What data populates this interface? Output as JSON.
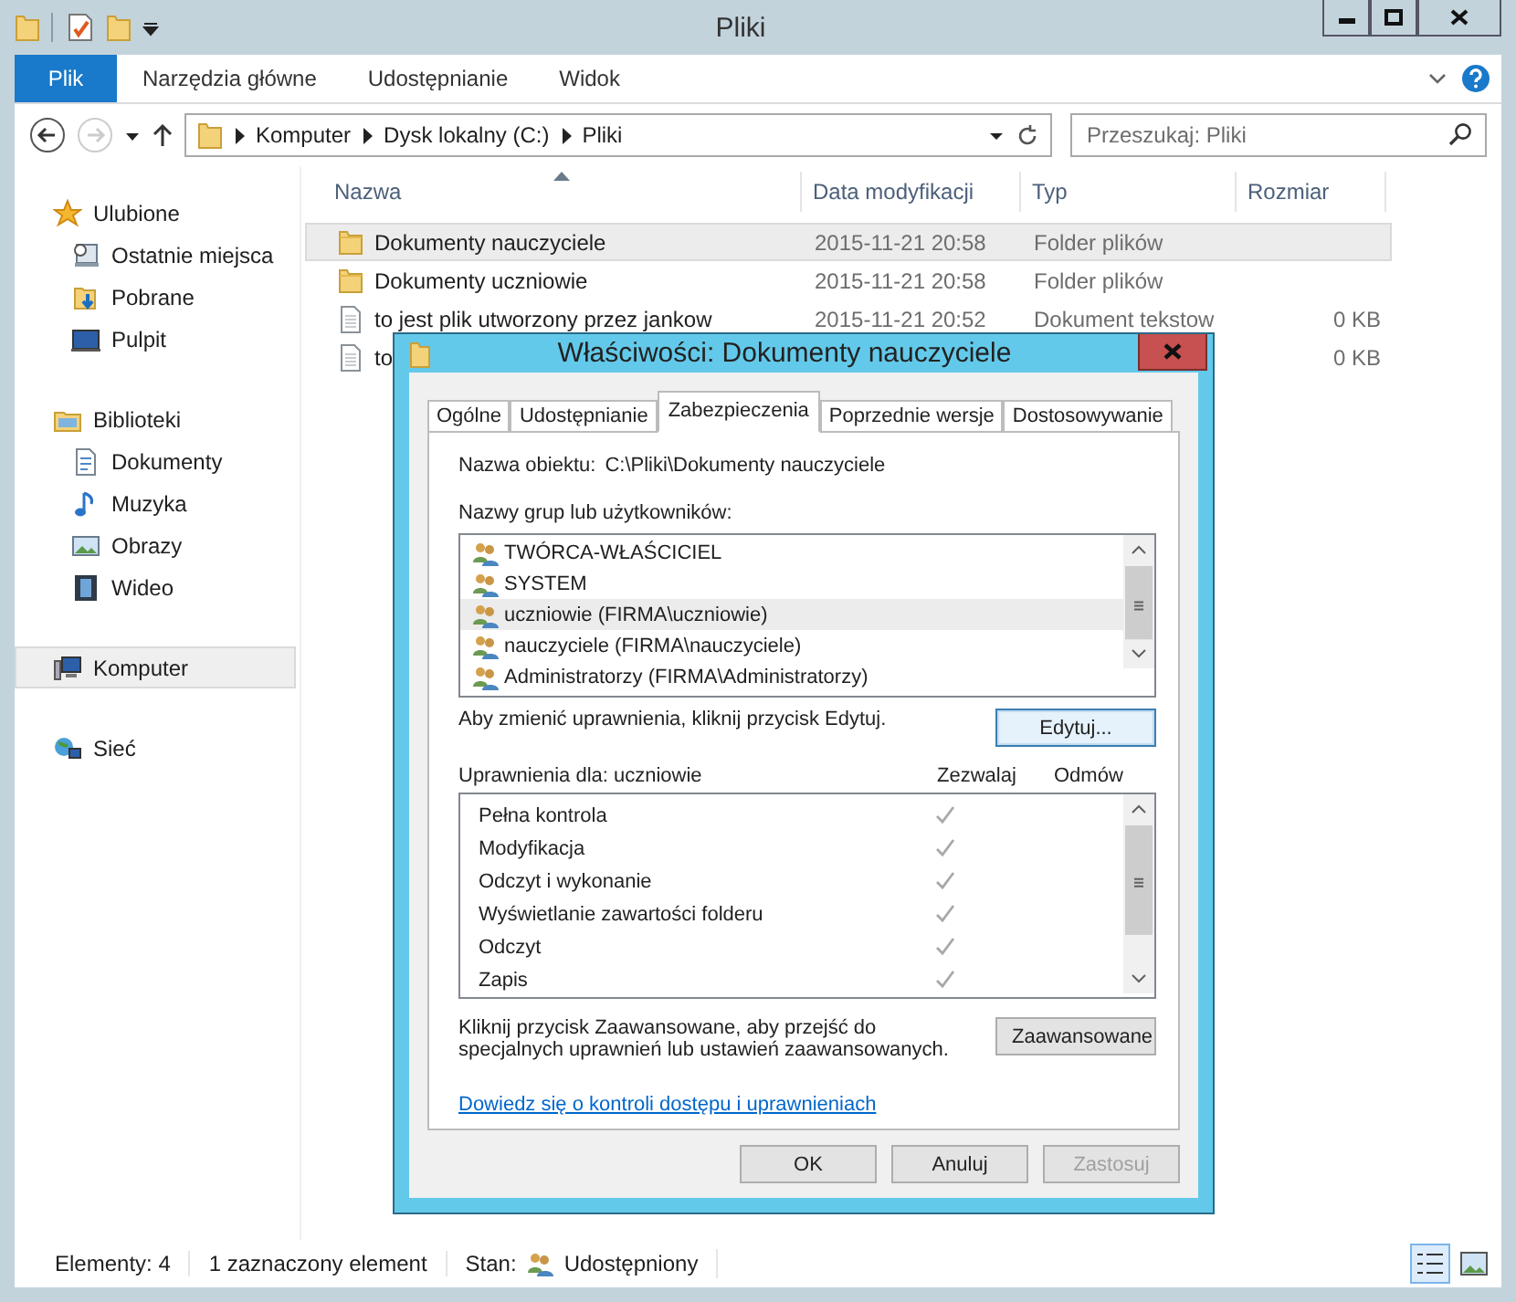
{
  "window": {
    "title": "Pliki"
  },
  "ribbon_tabs": [
    {
      "label": "Plik",
      "kind": "file"
    },
    {
      "label": "Narzędzia główne",
      "kind": "tab"
    },
    {
      "label": "Udostępnianie",
      "kind": "tab"
    },
    {
      "label": "Widok",
      "kind": "tab"
    }
  ],
  "address": {
    "path": [
      "Komputer",
      "Dysk lokalny (C:)",
      "Pliki"
    ]
  },
  "search": {
    "placeholder": "Przeszukaj: Pliki"
  },
  "nav": [
    {
      "label": "Ulubione",
      "kind": "star",
      "selected": false,
      "children": [
        {
          "label": "Ostatnie miejsca",
          "kind": "recent",
          "selected": false
        },
        {
          "label": "Pobrane",
          "kind": "download",
          "selected": false
        },
        {
          "label": "Pulpit",
          "kind": "desktop",
          "selected": false
        }
      ]
    },
    {
      "label": "Biblioteki",
      "kind": "library",
      "selected": false,
      "children": [
        {
          "label": "Dokumenty",
          "kind": "document",
          "selected": false
        },
        {
          "label": "Muzyka",
          "kind": "music",
          "selected": false
        },
        {
          "label": "Obrazy",
          "kind": "picture",
          "selected": false
        },
        {
          "label": "Wideo",
          "kind": "video",
          "selected": false
        }
      ]
    },
    {
      "label": "Komputer",
      "kind": "computer",
      "selected": true
    },
    {
      "label": "Sieć",
      "kind": "network",
      "selected": false
    }
  ],
  "columns": [
    "Nazwa",
    "Data modyfikacji",
    "Typ",
    "Rozmiar"
  ],
  "files": [
    {
      "kind": "folder",
      "name": "Dokumenty nauczyciele",
      "modified": "2015-11-21 20:58",
      "type": "Folder plików",
      "selected": true
    },
    {
      "kind": "folder",
      "name": "Dokumenty uczniowie",
      "modified": "2015-11-21 20:58",
      "type": "Folder plików",
      "selected": false
    },
    {
      "kind": "text",
      "name": "to jest plik utworzony przez jankow",
      "modified": "2015-11-21 20:52",
      "type": "Dokument tekstow",
      "size": "0 KB",
      "selected": false
    },
    {
      "kind": "text",
      "name": "to",
      "size": "0 KB",
      "selected": false
    }
  ],
  "status_bar": {
    "count": "Elementy: 4",
    "selection": "1 zaznaczony element",
    "state_label": "Stan:",
    "state": "Udostępniony",
    "views": [
      {
        "kind": "details",
        "selected": true
      },
      {
        "kind": "large",
        "selected": false
      }
    ]
  },
  "dialog": {
    "title": "Właściwości: Dokumenty nauczyciele",
    "tabs": [
      {
        "label": "Ogólne",
        "selected": false
      },
      {
        "label": "Udostępnianie",
        "selected": false
      },
      {
        "label": "Zabezpieczenia",
        "selected": true
      },
      {
        "label": "Poprzednie wersje",
        "selected": false
      },
      {
        "label": "Dostosowywanie",
        "selected": false
      }
    ],
    "object_label": "Nazwa obiektu:",
    "object_path": "C:\\Pliki\\Dokumenty nauczyciele",
    "users_label": "Nazwy grup lub użytkowników:",
    "users": [
      {
        "name": "TWÓRCA-WŁAŚCICIEL",
        "selected": false
      },
      {
        "name": "SYSTEM",
        "selected": false
      },
      {
        "name": "uczniowie (FIRMA\\uczniowie)",
        "selected": true
      },
      {
        "name": "nauczyciele (FIRMA\\nauczyciele)",
        "selected": false
      },
      {
        "name": "Administratorzy (FIRMA\\Administratorzy)",
        "selected": false
      }
    ],
    "edit_hint": "Aby zmienić uprawnienia, kliknij przycisk Edytuj.",
    "edit_button": "Edytuj...",
    "permissions_label": "Uprawnienia dla: uczniowie",
    "allow_label": "Zezwalaj",
    "deny_label": "Odmów",
    "permissions": [
      {
        "name": "Pełna kontrola",
        "allow": true,
        "deny": false
      },
      {
        "name": "Modyfikacja",
        "allow": true,
        "deny": false
      },
      {
        "name": "Odczyt i wykonanie",
        "allow": true,
        "deny": false
      },
      {
        "name": "Wyświetlanie zawartości folderu",
        "allow": true,
        "deny": false
      },
      {
        "name": "Odczyt",
        "allow": true,
        "deny": false
      },
      {
        "name": "Zapis",
        "allow": true,
        "deny": false
      }
    ],
    "advanced_hint": "Kliknij przycisk Zaawansowane, aby przejść do specjalnych uprawnień lub ustawień zaawansowanych.",
    "advanced_button": "Zaawansowane",
    "link": "Dowiedz się o kontroli dostępu i uprawnieniach",
    "buttons": [
      {
        "label": "OK",
        "disabled": false
      },
      {
        "label": "Anuluj",
        "disabled": false
      },
      {
        "label": "Zastosuj",
        "disabled": true
      }
    ]
  }
}
